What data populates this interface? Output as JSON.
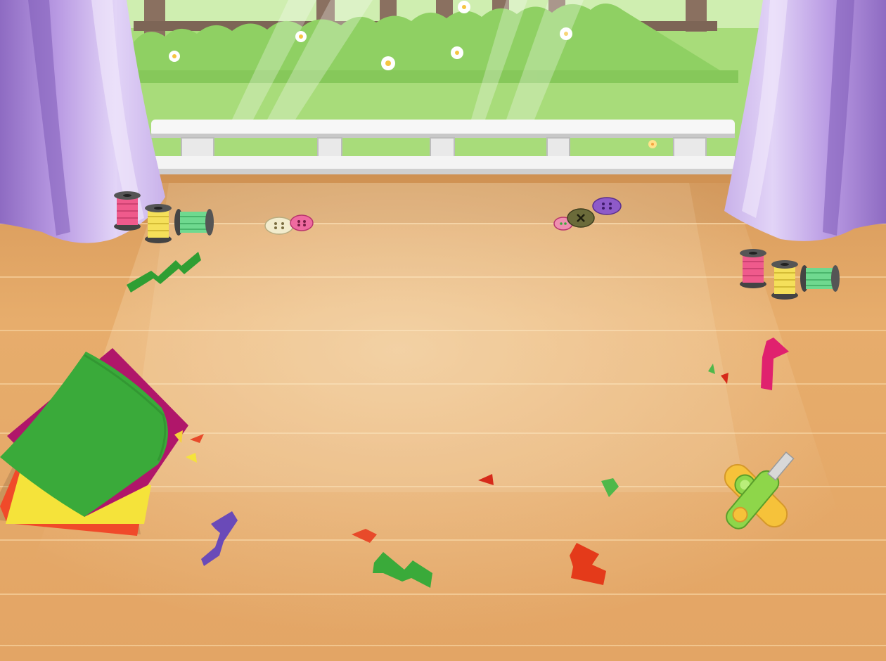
{
  "scene": {
    "name": "craft-room-floor",
    "colors": {
      "grass": "#a8dc7a",
      "hedge": "#8fd063",
      "floor": "#e2a766",
      "floor_dark": "#c98a4c",
      "curtain": "#c9b2ea",
      "curtain_dark": "#8e6bc2",
      "railing": "#f4f4f4"
    }
  },
  "props": {
    "spool_colors": [
      "#ef5a8c",
      "#f5e05a",
      "#6fd98f"
    ],
    "button_colors": [
      "#f2eccd",
      "#ef6aa0",
      "#6b6b3a",
      "#8e5ac9",
      "#ef8fb0"
    ],
    "paper_colors": [
      "#f02a2a",
      "#f5e33a",
      "#b0166a",
      "#3aaa3a"
    ],
    "cutter_colors": [
      "#f6c23a",
      "#8ed64a"
    ],
    "confetti_icons": [
      "zigzag-strip",
      "triangle-scrap",
      "folded-strip"
    ]
  }
}
